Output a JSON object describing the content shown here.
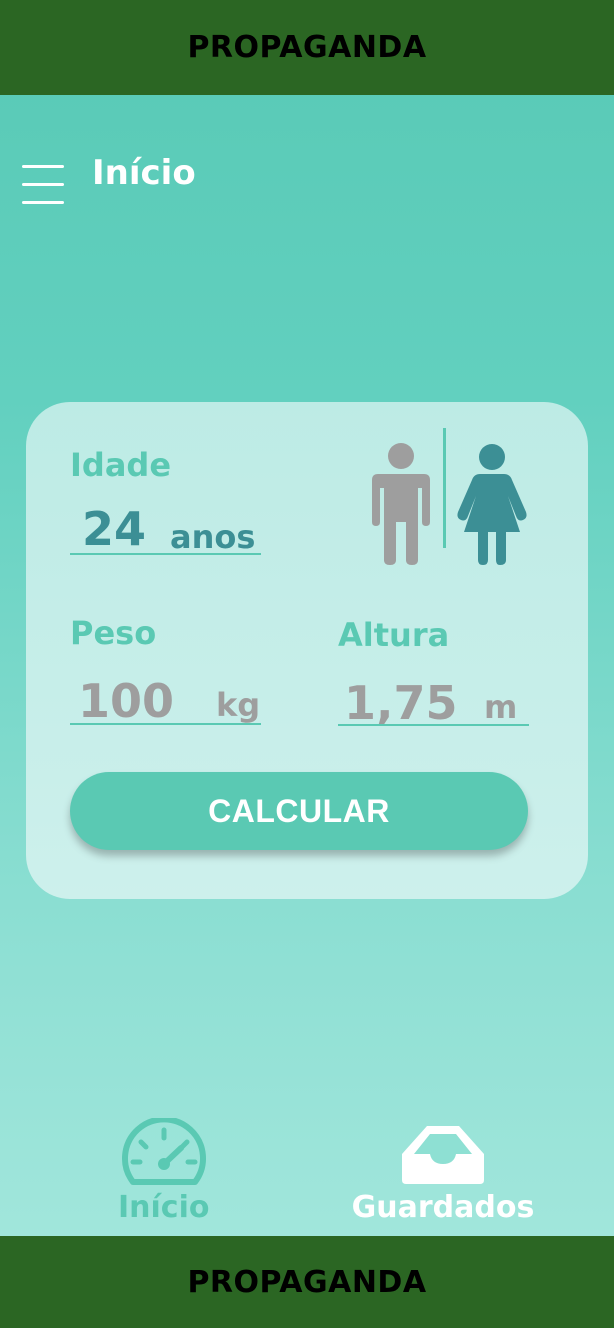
{
  "ads": {
    "top": "PROPAGANDA",
    "bottom": "PROPAGANDA"
  },
  "header": {
    "title": "Início",
    "menu_icon": "hamburger-menu-icon"
  },
  "form": {
    "age": {
      "label": "Idade",
      "value": "24",
      "unit": "anos"
    },
    "weight": {
      "label": "Peso",
      "value": "100",
      "unit": "kg"
    },
    "height": {
      "label": "Altura",
      "value": "1,75",
      "unit": "m"
    },
    "gender": {
      "options": [
        "male",
        "female"
      ],
      "selected": "female"
    },
    "calculate_label": "CALCULAR"
  },
  "bottom_nav": {
    "items": [
      {
        "label": "Início",
        "icon": "speedometer-icon",
        "active": true
      },
      {
        "label": "Guardados",
        "icon": "inbox-tray-icon",
        "active": false
      }
    ]
  },
  "colors": {
    "ad_banner": "#2b6623",
    "accent": "#5ac9b3",
    "selected_gender": "#3c8f95",
    "unselected_gender": "#9e9e9e",
    "card": "#c4ede8"
  }
}
